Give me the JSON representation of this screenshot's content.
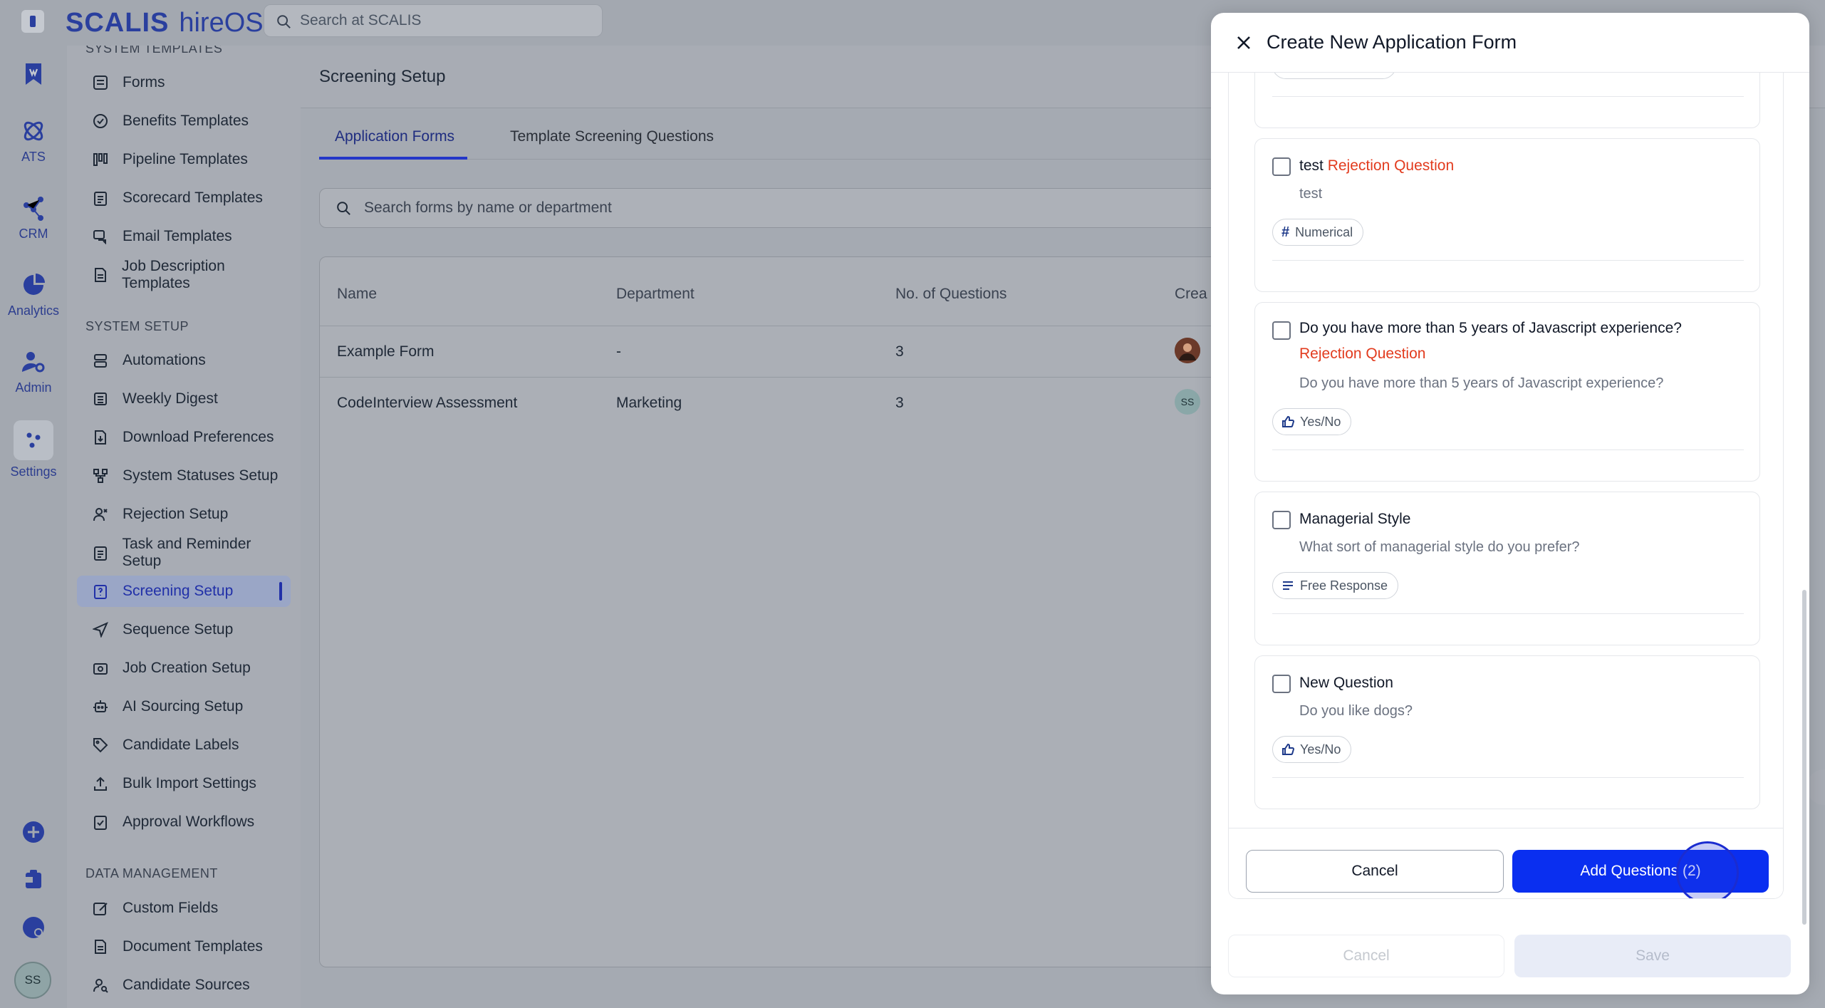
{
  "topbar": {
    "brand": "SCALIS",
    "brand_suffix": "hireOS",
    "search_placeholder": "Search at SCALIS"
  },
  "rail": {
    "items": [
      {
        "label": "",
        "icon": "bookmark-icon"
      },
      {
        "label": "ATS",
        "icon": "atom-icon"
      },
      {
        "label": "CRM",
        "icon": "network-icon"
      },
      {
        "label": "Analytics",
        "icon": "pie-icon"
      },
      {
        "label": "Admin",
        "icon": "admin-icon"
      },
      {
        "label": "Settings",
        "icon": "settings-icon"
      }
    ],
    "avatar": "SS"
  },
  "sidebar": {
    "system_templates_title": "SYSTEM TEMPLATES",
    "templates": [
      "Forms",
      "Benefits Templates",
      "Pipeline Templates",
      "Scorecard Templates",
      "Email Templates",
      "Job Description Templates"
    ],
    "system_setup_title": "SYSTEM SETUP",
    "setup": [
      "Automations",
      "Weekly Digest",
      "Download Preferences",
      "System Statuses Setup",
      "Rejection Setup",
      "Task and Reminder Setup",
      "Screening Setup",
      "Sequence Setup",
      "Job Creation Setup",
      "AI Sourcing Setup",
      "Candidate Labels",
      "Bulk Import Settings",
      "Approval Workflows"
    ],
    "data_management_title": "DATA MANAGEMENT",
    "data": [
      "Custom Fields",
      "Document Templates",
      "Candidate Sources"
    ]
  },
  "main": {
    "title": "Screening Setup",
    "tabs": [
      "Application Forms",
      "Template Screening Questions"
    ],
    "search_placeholder": "Search forms by name or department",
    "columns": [
      "Name",
      "Department",
      "No. of Questions",
      "Crea"
    ],
    "rows": [
      {
        "name": "Example Form",
        "department": "-",
        "questions": "3",
        "creator": ""
      },
      {
        "name": "CodeInterview Assessment",
        "department": "Marketing",
        "questions": "3",
        "creator": "SS"
      }
    ]
  },
  "drawer": {
    "title": "Create New Application Form",
    "questions": [
      {
        "title": "test",
        "rejection": "Rejection Question",
        "desc": "test",
        "type": "Numerical",
        "type_icon": "hash-icon"
      },
      {
        "title": "Do you have more than 5 years of Javascript experience?",
        "rejection": "Rejection Question",
        "desc": "Do you have more than 5 years of Javascript experience?",
        "type": "Yes/No",
        "type_icon": "thumbs-up-icon"
      },
      {
        "title": "Managerial Style",
        "rejection": "",
        "desc": "What sort of managerial style do you prefer?",
        "type": "Free Response",
        "type_icon": "lines-icon"
      },
      {
        "title": "New Question",
        "rejection": "",
        "desc": "Do you like dogs?",
        "type": "Yes/No",
        "type_icon": "thumbs-up-icon"
      }
    ],
    "inner_cancel": "Cancel",
    "add_button": "Add Questions (2)",
    "footer_cancel": "Cancel",
    "footer_save": "Save"
  },
  "colors": {
    "accent": "#0a2ff0",
    "rejection": "#e23b1e"
  }
}
